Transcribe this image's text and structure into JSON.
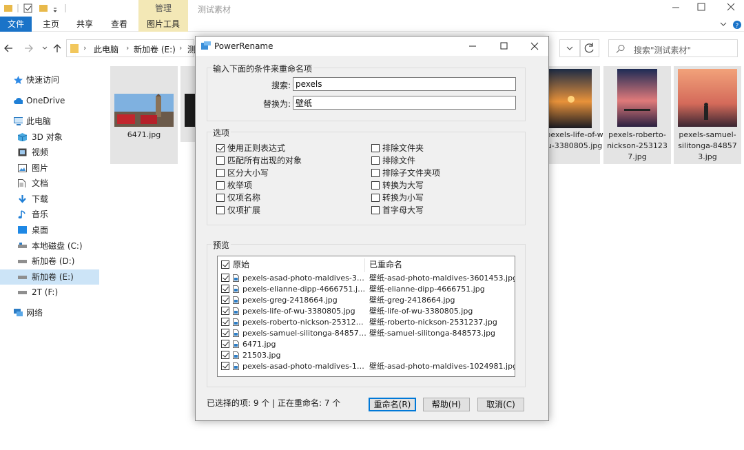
{
  "explorer": {
    "title": "测试素材",
    "ribbon_context_tab": "管理",
    "tabs": [
      "文件",
      "主页",
      "共享",
      "查看",
      "图片工具"
    ],
    "breadcrumb": [
      "此电脑",
      "新加卷 (E:)",
      "测"
    ],
    "search_placeholder": "搜索\"测试素材\"",
    "nav": [
      {
        "label": "快速访问",
        "icon": "star-icon"
      },
      {
        "label": "OneDrive",
        "icon": "cloud-icon"
      },
      {
        "label": "此电脑",
        "icon": "computer-icon"
      },
      {
        "label": "3D 对象",
        "icon": "cube-icon"
      },
      {
        "label": "视频",
        "icon": "video-icon"
      },
      {
        "label": "图片",
        "icon": "picture-icon"
      },
      {
        "label": "文档",
        "icon": "document-icon"
      },
      {
        "label": "下载",
        "icon": "download-icon"
      },
      {
        "label": "音乐",
        "icon": "music-icon"
      },
      {
        "label": "桌面",
        "icon": "desktop-icon"
      },
      {
        "label": "本地磁盘 (C:)",
        "icon": "drive-icon"
      },
      {
        "label": "新加卷 (D:)",
        "icon": "drive-icon"
      },
      {
        "label": "新加卷 (E:)",
        "icon": "drive-icon"
      },
      {
        "label": "2T (F:)",
        "icon": "drive-icon"
      },
      {
        "label": "网络",
        "icon": "network-icon"
      }
    ],
    "thumbnails": [
      {
        "caption": "6471.jpg"
      },
      {
        "caption": "pexels-life-of-w\nu-3380805.jpg"
      },
      {
        "caption": "pexels-roberto-\nnickson-253123\n7.jpg"
      },
      {
        "caption": "pexels-samuel-\nsilitonga-84857\n3.jpg"
      }
    ]
  },
  "dialog": {
    "title": "PowerRename",
    "criteria_group": "输入下面的条件来重命名项",
    "search_label": "搜索:",
    "search_value": "pexels",
    "replace_label": "替换为:",
    "replace_value": "壁纸",
    "options_group": "选项",
    "options_left": [
      {
        "label": "使用正则表达式",
        "checked": true
      },
      {
        "label": "匹配所有出现的对象",
        "checked": false
      },
      {
        "label": "区分大小写",
        "checked": false
      },
      {
        "label": "枚举项",
        "checked": false
      },
      {
        "label": "仅项名称",
        "checked": false
      },
      {
        "label": "仅项扩展",
        "checked": false
      }
    ],
    "options_right": [
      {
        "label": "排除文件夹",
        "checked": false
      },
      {
        "label": "排除文件",
        "checked": false
      },
      {
        "label": "排除子文件夹项",
        "checked": false
      },
      {
        "label": "转换为大写",
        "checked": false
      },
      {
        "label": "转换为小写",
        "checked": false
      },
      {
        "label": "首字母大写",
        "checked": false
      }
    ],
    "preview_group": "预览",
    "col_original": "原始",
    "col_renamed": "已重命名",
    "rows": [
      {
        "original": "pexels-asad-photo-maldives-360145...",
        "renamed": "壁纸-asad-photo-maldives-3601453.jpg"
      },
      {
        "original": "pexels-elianne-dipp-4666751.jpg",
        "renamed": "壁纸-elianne-dipp-4666751.jpg"
      },
      {
        "original": "pexels-greg-2418664.jpg",
        "renamed": "壁纸-greg-2418664.jpg"
      },
      {
        "original": "pexels-life-of-wu-3380805.jpg",
        "renamed": "壁纸-life-of-wu-3380805.jpg"
      },
      {
        "original": "pexels-roberto-nickson-2531237.jpg",
        "renamed": "壁纸-roberto-nickson-2531237.jpg"
      },
      {
        "original": "pexels-samuel-silitonga-848573.jpg",
        "renamed": "壁纸-samuel-silitonga-848573.jpg"
      },
      {
        "original": "6471.jpg",
        "renamed": ""
      },
      {
        "original": "21503.jpg",
        "renamed": ""
      },
      {
        "original": "pexels-asad-photo-maldives-102498...",
        "renamed": "壁纸-asad-photo-maldives-1024981.jpg"
      }
    ],
    "status": "已选择的项: 9 个 | 正在重命名: 7 个",
    "rename_button": "重命名(R)",
    "help_button": "帮助(H)",
    "cancel_button": "取消(C)"
  }
}
